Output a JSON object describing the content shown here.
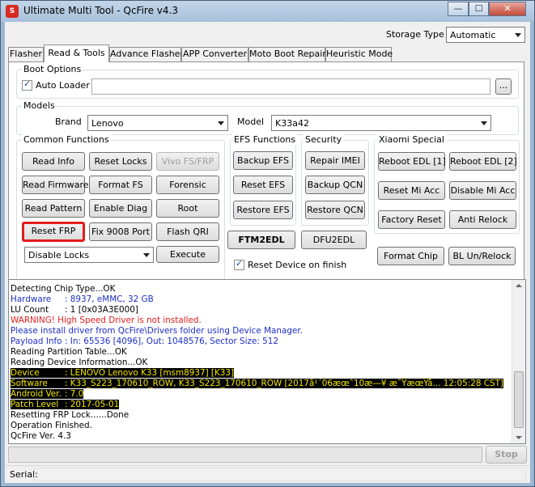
{
  "window": {
    "icon_letter": "S",
    "title": "Ultimate Multi Tool - QcFire v4.3",
    "controls": {
      "minimize": "—",
      "maximize": "☐",
      "close": "✕"
    }
  },
  "storage": {
    "label": "Storage Type",
    "selected": "Automatic"
  },
  "tabs": [
    {
      "label": "Flasher",
      "active": false
    },
    {
      "label": "Read & Tools",
      "active": true
    },
    {
      "label": "Advance Flasher",
      "active": false
    },
    {
      "label": "APP Converter",
      "active": false
    },
    {
      "label": "Moto Boot Repair",
      "active": false
    },
    {
      "label": "Heuristic Mode",
      "active": false
    }
  ],
  "boot_options": {
    "title": "Boot Options",
    "auto_loader": {
      "label": "Auto Loader",
      "checked": true
    },
    "loader_path": "",
    "browse_label": "..."
  },
  "models": {
    "title": "Models",
    "brand_label": "Brand",
    "brand_value": "Lenovo",
    "model_label": "Model",
    "model_value": "K33a42"
  },
  "common_functions": {
    "title": "Common Functions",
    "buttons": {
      "read_info": "Read Info",
      "reset_locks": "Reset Locks",
      "vivo_fs_frp": "Vivo FS/FRP",
      "read_firmware": "Read Firmware",
      "format_fs": "Format FS",
      "forensic": "Forensic",
      "read_pattern": "Read Pattern",
      "enable_diag": "Enable Diag",
      "root": "Root",
      "reset_frp": "Reset FRP",
      "fix_9008_port": "Fix 9008 Port",
      "flash_qri": "Flash QRI",
      "execute": "Execute"
    },
    "lock_select": "Disable Locks"
  },
  "efs_functions": {
    "title": "EFS Functions",
    "backup_efs": "Backup EFS",
    "reset_efs": "Reset EFS",
    "restore_efs": "Restore EFS"
  },
  "security": {
    "title": "Security",
    "repair_imei": "Repair IMEI",
    "backup_qcn": "Backup QCN",
    "restore_qcn": "Restore QCN"
  },
  "ftm2edl": "FTM2EDL",
  "dfu2edl": "DFU2EDL",
  "reset_on_finish": {
    "label": "Reset Device on finish",
    "checked": true
  },
  "xiaomi_special": {
    "title": "Xiaomi Special",
    "reboot_edl_1": "Reboot EDL [1]",
    "reboot_edl_2": "Reboot EDL [2]",
    "reset_mi_acc": "Reset Mi Acc",
    "disable_mi_acc": "Disable Mi Acc",
    "factory_reset": "Factory Reset",
    "anti_relock": "Anti Relock"
  },
  "format_chip": "Format Chip",
  "bl_unrelock": "BL Un/Relock",
  "log": [
    {
      "text": "Detecting Chip Type...OK",
      "color": "black"
    },
    {
      "key": "Hardware",
      "value": ": 8937, eMMC, 32 GB",
      "color": "blue"
    },
    {
      "key": "LU Count",
      "value": ": 1 [0x03A3E000]",
      "color": "black"
    },
    {
      "text": "WARNING! High Speed Driver is not installed.",
      "color": "red"
    },
    {
      "text": "Please install driver from QcFire\\Drivers folder using Device Manager.",
      "color": "blue"
    },
    {
      "key": "Payload Info",
      "value": ": In: 65536 [4096], Out: 1048576, Sector Size: 512",
      "color": "blue"
    },
    {
      "text": "Reading Partition Table...OK",
      "color": "black"
    },
    {
      "text": "Reading Device Information...OK",
      "color": "black"
    },
    {
      "key": "Device",
      "value": ": LENOVO Lenovo K33 [msm8937] [K33]",
      "color": "hl"
    },
    {
      "key": "Software",
      "value": ": K33_S223_170610_ROW, K33_S223_170610_ROW [2017å¹´06æœˆ10æ—¥ æ˜ŸæœŸå... 12:05:28 CST]",
      "color": "hl"
    },
    {
      "key": "Android Ver.",
      "value": ": 7.0",
      "color": "hl"
    },
    {
      "key": "Patch Level",
      "value": ": 2017-05-01",
      "color": "hl"
    },
    {
      "text": "Resetting FRP Lock......Done",
      "color": "black"
    },
    {
      "text": "Operation Finished.",
      "color": "black"
    },
    {
      "text": "QcFire Ver. 4.3",
      "color": "black"
    }
  ],
  "progress": {
    "value": 0
  },
  "stop_label": "Stop",
  "status": {
    "serial_label": "Serial:",
    "serial_value": ""
  }
}
